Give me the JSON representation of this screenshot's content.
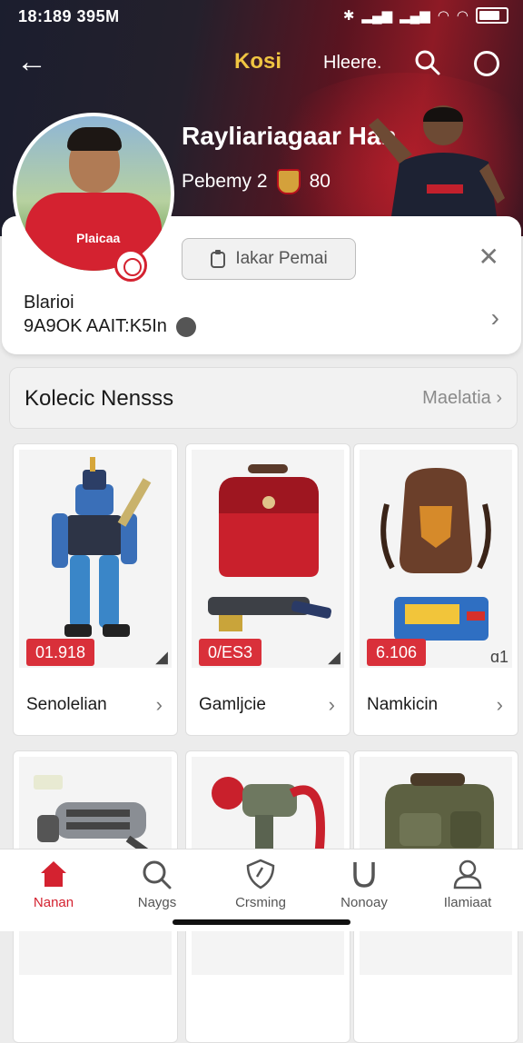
{
  "status": {
    "time": "18:189 395M",
    "icons": [
      "bluetooth-icon",
      "signal-icon",
      "signal-icon",
      "wifi-icon",
      "wifi-icon",
      "battery-icon"
    ]
  },
  "topbar": {
    "brand": "Kosi",
    "help": "Hleere.",
    "icons": [
      "back-arrow-icon",
      "search-icon",
      "circle-icon"
    ]
  },
  "profile": {
    "name": "Rayliariagaar Han",
    "subtitle": "Pebemy 2",
    "level": "80",
    "jersey_text": "Plaicaa",
    "follow_label": "Iakar Pemai",
    "label": "Blarioi",
    "code": "9A9OK AAIT:K5In"
  },
  "collection": {
    "title": "Kolecic Nensss",
    "link": "Maelatia"
  },
  "items": [
    {
      "name": "Senolelian",
      "price": "01.918"
    },
    {
      "name": "Gamljcie",
      "price": "0/ES3"
    },
    {
      "name": "Namkicin",
      "price": "6.106",
      "corner": "ɑ1"
    }
  ],
  "tabs": [
    {
      "label": "Nanan",
      "icon": "home-icon",
      "active": true
    },
    {
      "label": "Naygs",
      "icon": "search-icon"
    },
    {
      "label": "Crsming",
      "icon": "shield-icon"
    },
    {
      "label": "Nonoay",
      "icon": "horseshoe-icon"
    },
    {
      "label": "Ilamiaat",
      "icon": "person-icon"
    }
  ],
  "colors": {
    "accent": "#d42230",
    "header_dark": "#1b1e2e",
    "brand_gold": "#f0c542"
  }
}
